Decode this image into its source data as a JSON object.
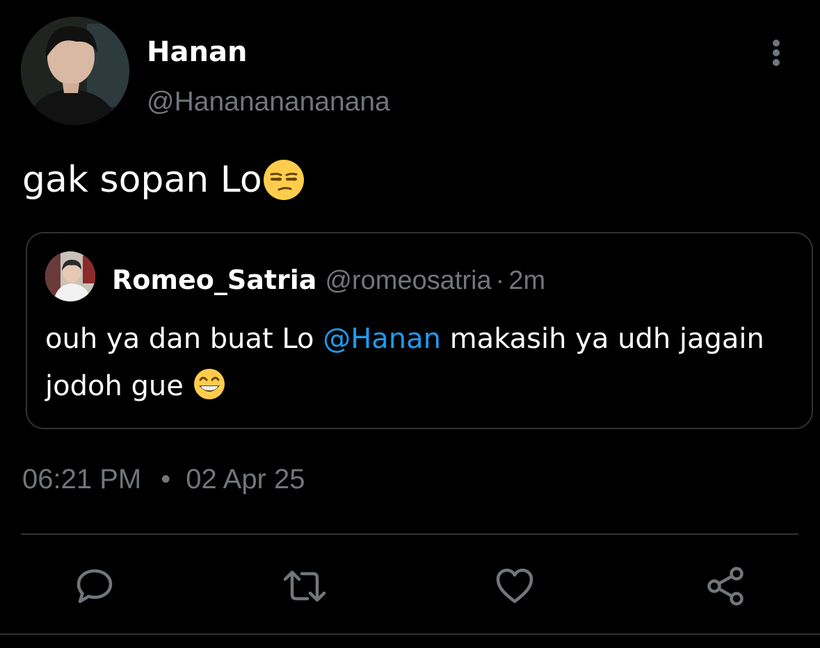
{
  "tweet": {
    "author": {
      "display_name": "Hanan",
      "handle": "@Hanananananana"
    },
    "text": "gak sopan Lo",
    "text_emoji": "unamused-face-emoji",
    "quoted_tweet": {
      "display_name": "Romeo_Satria",
      "handle": "@romeosatria",
      "separator": "·",
      "relative_time": "2m",
      "text_before_mention": "ouh ya dan buat Lo ",
      "mention": "@Hanan",
      "text_after_mention": " makasih ya udh jagain jodoh gue ",
      "text_emoji": "grinning-face-with-smiling-eyes-emoji"
    },
    "time": "06:21 PM",
    "date_separator": "•",
    "date": "02 Apr 25"
  },
  "actions": [
    {
      "name": "reply",
      "icon": "reply-icon"
    },
    {
      "name": "retweet",
      "icon": "retweet-icon"
    },
    {
      "name": "like",
      "icon": "heart-icon"
    },
    {
      "name": "share",
      "icon": "share-icon"
    }
  ],
  "colors": {
    "background": "#000000",
    "primary_text": "#ffffff",
    "secondary_text": "#71767b",
    "mention": "#1d9bf0",
    "border": "#2f3336",
    "emoji_yellow": "#ffcc4d"
  }
}
